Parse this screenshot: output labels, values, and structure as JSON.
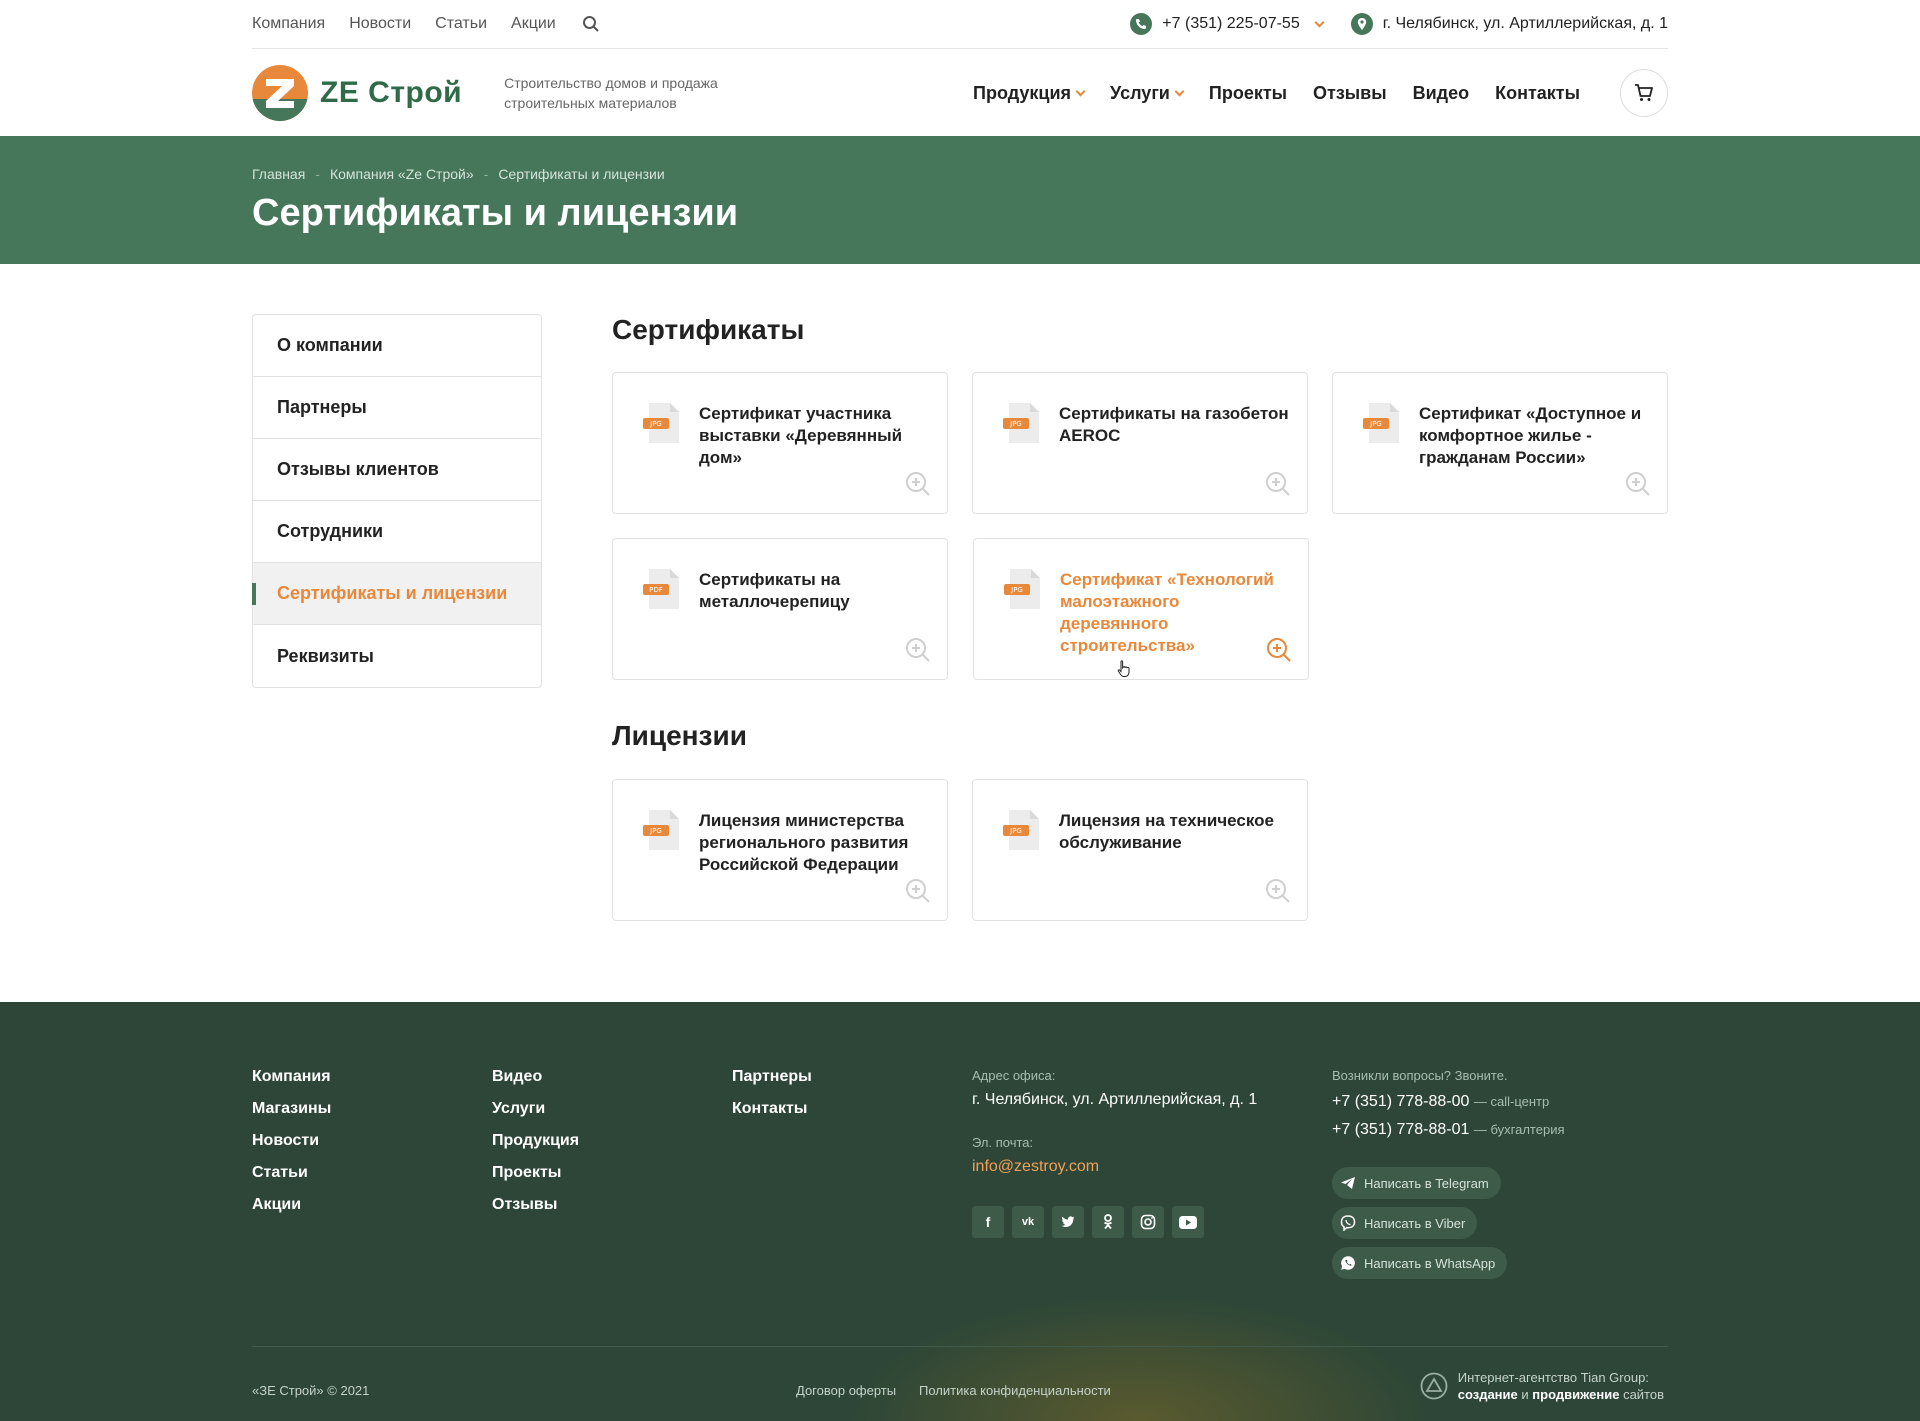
{
  "topbar": {
    "nav": [
      "Компания",
      "Новости",
      "Статьи",
      "Акции"
    ],
    "phone": "+7 (351) 225-07-55",
    "address": "г. Челябинск, ул. Артиллерийская, д. 1"
  },
  "header": {
    "logo_text": "ZE Строй",
    "tagline": "Строительство домов и продажа строительных материалов",
    "nav": [
      {
        "label": "Продукция",
        "dropdown": true
      },
      {
        "label": "Услуги",
        "dropdown": true
      },
      {
        "label": "Проекты",
        "dropdown": false
      },
      {
        "label": "Отзывы",
        "dropdown": false
      },
      {
        "label": "Видео",
        "dropdown": false
      },
      {
        "label": "Контакты",
        "dropdown": false
      }
    ]
  },
  "breadcrumbs": [
    "Главная",
    "Компания «Ze Строй»",
    "Сертификаты и лицензии"
  ],
  "page_title": "Сертификаты и лицензии",
  "sidebar": {
    "items": [
      {
        "label": "О компании",
        "active": false
      },
      {
        "label": "Партнеры",
        "active": false
      },
      {
        "label": "Отзывы клиентов",
        "active": false
      },
      {
        "label": "Сотрудники",
        "active": false
      },
      {
        "label": "Сертификаты и лицензии",
        "active": true
      },
      {
        "label": "Реквизиты",
        "active": false
      }
    ]
  },
  "certificates": {
    "title": "Сертификаты",
    "items": [
      {
        "title": "Сертификат участника выставки «Деревянный дом»",
        "type": "JPG"
      },
      {
        "title": "Сертификаты на газобетон AEROC",
        "type": "JPG"
      },
      {
        "title": "Сертификат «Доступное и комфортное жилье - гражданам России»",
        "type": "JPG"
      },
      {
        "title": "Сертификаты на металлочерепицу",
        "type": "PDF"
      },
      {
        "title": "Сертификат «Технологий малоэтажного деревянного строительства»",
        "type": "JPG",
        "hover": true
      }
    ]
  },
  "licenses": {
    "title": "Лицензии",
    "items": [
      {
        "title": "Лицензия министерства регионального развития Российской Федерации",
        "type": "JPG"
      },
      {
        "title": "Лицензия на техническое обслуживание",
        "type": "JPG"
      }
    ]
  },
  "footer": {
    "col1": [
      "Компания",
      "Магазины",
      "Новости",
      "Статьи",
      "Акции"
    ],
    "col2": [
      "Видео",
      "Услуги",
      "Продукция",
      "Проекты",
      "Отзывы"
    ],
    "col3": [
      "Партнеры",
      "Контакты"
    ],
    "office_label": "Адрес офиса:",
    "office_address": "г. Челябинск, ул. Артиллерийская, д. 1",
    "email_label": "Эл. почта:",
    "email": "info@zestroy.com",
    "questions_label": "Возникли вопросы? Звоните.",
    "phones": [
      {
        "number": "+7 (351) 778-88-00",
        "note": "— call-центр"
      },
      {
        "number": "+7 (351) 778-88-01",
        "note": "— бухгалтерия"
      }
    ],
    "messengers": [
      "Написать в Telegram",
      "Написать в Viber",
      "Написать в WhatsApp"
    ],
    "copyright": "«ЗЕ Строй» © 2021",
    "offer": "Договор оферты",
    "privacy": "Политика конфиденциальности",
    "agency_line1": "Интернет-агентство Tian Group:",
    "agency_word1": "создание",
    "agency_and": "и",
    "agency_word2": "продвижение",
    "agency_word3": "сайтов"
  },
  "colors": {
    "brand_green": "#46775a",
    "accent_orange": "#e8883a",
    "footer_bg": "#2d4637"
  }
}
